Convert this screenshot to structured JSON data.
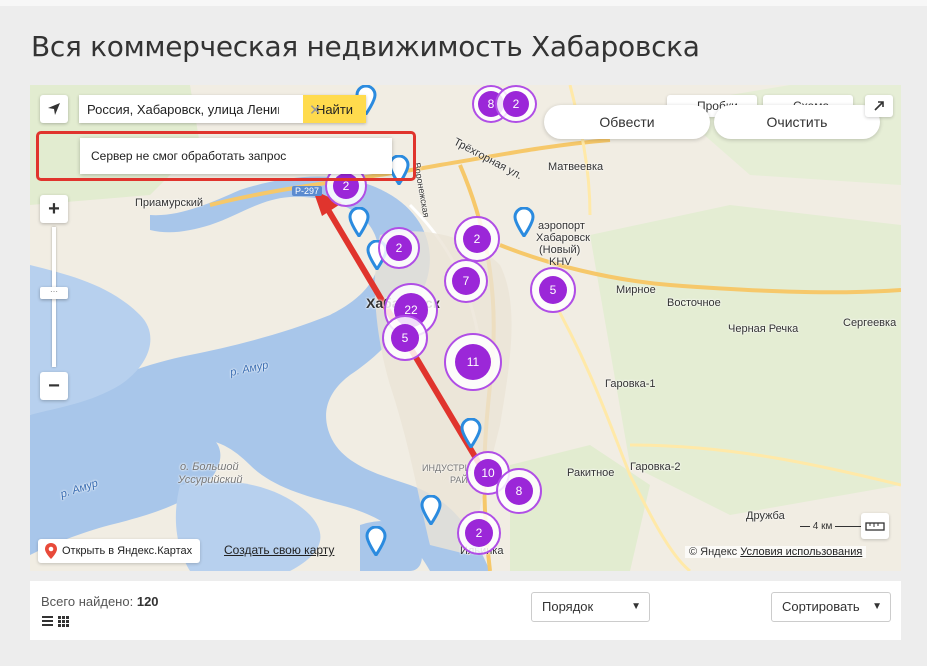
{
  "page": {
    "title": "Вся коммерческая недвижимость Хабаровска"
  },
  "search": {
    "value": "Россия, Хабаровск, улица Ленина",
    "button": "Найти",
    "error": "Сервер не смог обработать запрос"
  },
  "controls": {
    "apply": "Обвести",
    "clear": "Очистить",
    "traffic": "Пробки",
    "layers": "Схема"
  },
  "clusters": [
    "8",
    "2",
    "2",
    "2",
    "2",
    "7",
    "5",
    "22",
    "5",
    "11",
    "10",
    "8",
    "2"
  ],
  "places": {
    "priamursky": "Приамурский",
    "matveevka": "Матвеевка",
    "trekhgornaya": "Трёхгорная ул.",
    "airport1": "аэропорт",
    "airport2": "Хабаровск",
    "airport3": "(Новый)",
    "airport4": "KHV",
    "mirnoe": "Мирное",
    "vostochnoe": "Восточное",
    "chernaya": "Черная Речка",
    "sergeevka": "Сергеевка",
    "garovka1": "Гаровка-1",
    "garovka2": "Гаровка-2",
    "rakitnoe": "Ракитное",
    "druzhba": "Дружба",
    "industr": "ИНДУСТРИ",
    "rai": "РАЙ",
    "city": "Хабаровск",
    "amur1": "р. Амур",
    "amur2": "р. Амур",
    "ussuri1": "о. Большой",
    "ussuri2": "Уссурийский",
    "r297": "Р-297",
    "ilinka": "Ильинка",
    "voronezh": "Воронежская"
  },
  "map_footer": {
    "open": "Открыть в Яндекс.Картах",
    "create": "Создать свою карту",
    "copyright": "© Яндекс",
    "terms": "Условия использования",
    "scale": "4 км"
  },
  "results": {
    "found_label": "Всего найдено:",
    "found_count": "120",
    "order": "Порядок",
    "sort": "Сортировать"
  }
}
